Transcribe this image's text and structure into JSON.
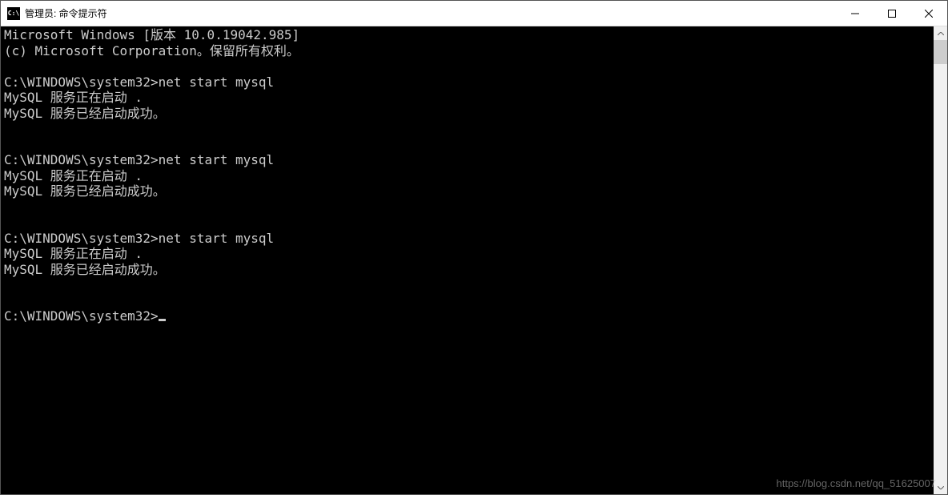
{
  "titlebar": {
    "icon_text": "C:\\",
    "title": "管理员: 命令提示符"
  },
  "terminal": {
    "lines": [
      "Microsoft Windows [版本 10.0.19042.985]",
      "(c) Microsoft Corporation。保留所有权利。",
      "",
      "C:\\WINDOWS\\system32>net start mysql",
      "MySQL 服务正在启动 .",
      "MySQL 服务已经启动成功。",
      "",
      "",
      "C:\\WINDOWS\\system32>net start mysql",
      "MySQL 服务正在启动 .",
      "MySQL 服务已经启动成功。",
      "",
      "",
      "C:\\WINDOWS\\system32>net start mysql",
      "MySQL 服务正在启动 .",
      "MySQL 服务已经启动成功。",
      "",
      ""
    ],
    "prompt": "C:\\WINDOWS\\system32>"
  },
  "watermark": "https://blog.csdn.net/qq_51625007"
}
